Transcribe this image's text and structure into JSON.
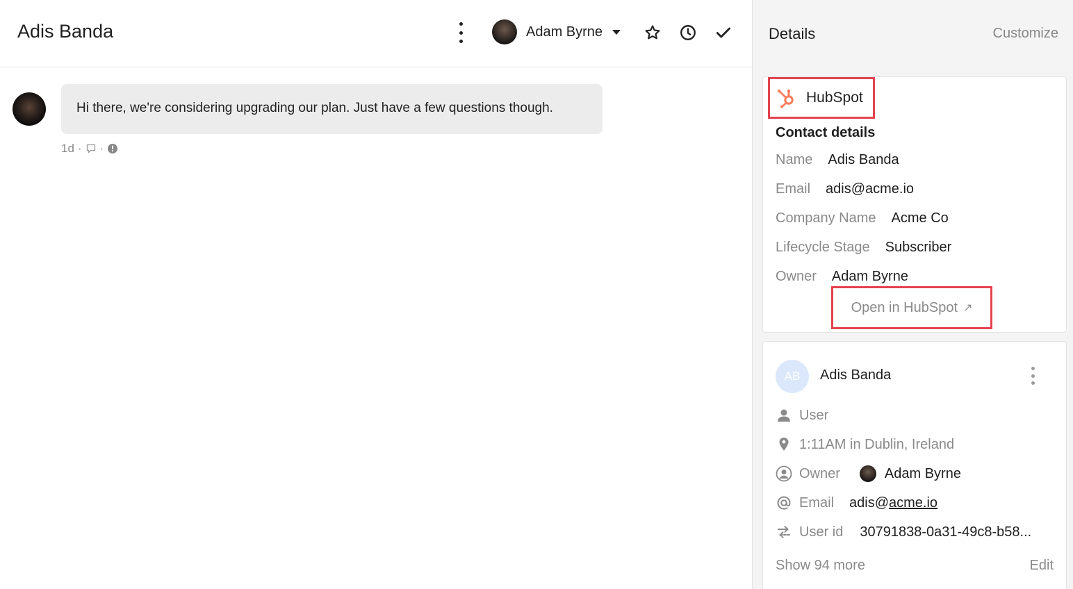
{
  "conversation": {
    "title": "Adis Banda",
    "assignee_name": "Adam Byrne",
    "message": {
      "text": "Hi there, we're considering upgrading our plan. Just have a few questions though.",
      "age": "1d"
    }
  },
  "details": {
    "title": "Details",
    "customize_label": "Customize"
  },
  "hubspot": {
    "brand": "HubSpot",
    "section": "Contact details",
    "fields": [
      {
        "label": "Name",
        "value": "Adis Banda"
      },
      {
        "label": "Email",
        "value": "adis@acme.io"
      },
      {
        "label": "Company Name",
        "value": "Acme Co"
      },
      {
        "label": "Lifecycle Stage",
        "value": "Subscriber"
      },
      {
        "label": "Owner",
        "value": "Adam Byrne"
      }
    ],
    "open_label": "Open in HubSpot",
    "open_arrow": "↗"
  },
  "user_card": {
    "initials": "AB",
    "name": "Adis Banda",
    "type": "User",
    "location": "1:11AM in Dublin, Ireland",
    "owner_label": "Owner",
    "owner_value": "Adam Byrne",
    "email_label": "Email",
    "email_user": "adis@",
    "email_domain": "acme.io",
    "user_id_label": "User id",
    "user_id_value": "30791838-0a31-49c8-b58...",
    "show_more": "Show 94 more",
    "edit": "Edit"
  },
  "colors": {
    "highlight": "#e4434f",
    "hubspot_orange": "#ff7a59",
    "muted": "#8a8a8a"
  },
  "icons": [
    "more-vertical-icon",
    "caret-down-icon",
    "star-icon",
    "clock-icon",
    "check-icon",
    "note-icon",
    "alert-icon",
    "hubspot-icon",
    "user-icon",
    "location-icon",
    "owner-icon",
    "at-icon",
    "sync-icon",
    "external-arrow-icon"
  ]
}
